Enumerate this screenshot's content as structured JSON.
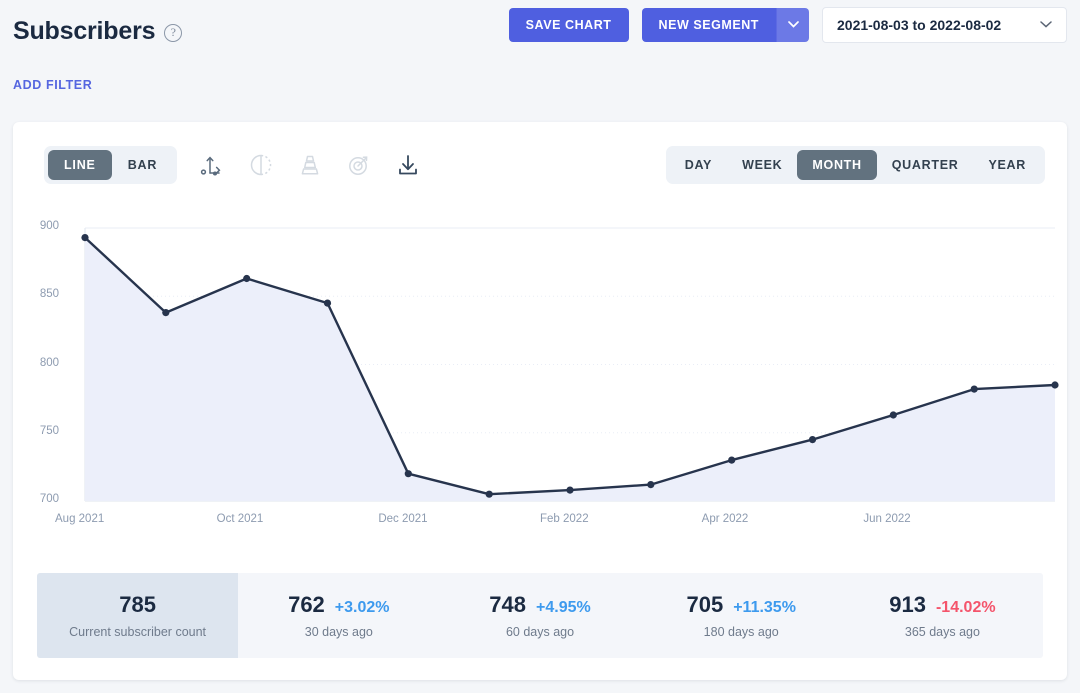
{
  "header": {
    "title": "Subscribers",
    "help_icon": "question-mark-circle-icon",
    "save_chart_label": "SAVE CHART",
    "new_segment_label": "NEW SEGMENT",
    "new_segment_caret": "⌄",
    "date_range": "2021-08-03 to 2022-08-02",
    "date_caret": "⌄",
    "add_filter_label": "ADD FILTER"
  },
  "toolbar": {
    "chart_types": [
      {
        "label": "LINE",
        "active": true
      },
      {
        "label": "BAR",
        "active": false
      }
    ],
    "icons": [
      {
        "name": "scatter-axis-icon",
        "dim": false
      },
      {
        "name": "pie-chart-icon",
        "dim": true
      },
      {
        "name": "funnel-icon",
        "dim": true
      },
      {
        "name": "goal-target-icon",
        "dim": true
      },
      {
        "name": "download-icon",
        "dim": false
      }
    ],
    "periods": [
      {
        "label": "DAY",
        "active": false
      },
      {
        "label": "WEEK",
        "active": false
      },
      {
        "label": "MONTH",
        "active": true
      },
      {
        "label": "QUARTER",
        "active": false
      },
      {
        "label": "YEAR",
        "active": false
      }
    ]
  },
  "chart_data": {
    "type": "line",
    "title": "Subscribers",
    "xlabel": "",
    "ylabel": "",
    "ylim": [
      700,
      900
    ],
    "yticks": [
      900,
      850,
      800,
      750,
      700
    ],
    "xticks": [
      "Aug 2021",
      "Oct 2021",
      "Dec 2021",
      "Feb 2022",
      "Apr 2022",
      "Jun 2022"
    ],
    "grid": true,
    "legend": "none",
    "area_fill": true,
    "line_color": "#27344d",
    "fill_color": "#eceffa",
    "categories": [
      "Aug 2021",
      "Sep 2021",
      "Oct 2021",
      "Nov 2021",
      "Dec 2021",
      "Jan 2022",
      "Feb 2022",
      "Mar 2022",
      "Apr 2022",
      "May 2022",
      "Jun 2022",
      "Jul 2022",
      "Aug 2022"
    ],
    "values": [
      893,
      838,
      863,
      845,
      720,
      705,
      708,
      712,
      730,
      745,
      763,
      782,
      785
    ]
  },
  "stats": [
    {
      "value": "785",
      "delta": "",
      "delta_dir": "none",
      "label": "Current subscriber count",
      "current": true
    },
    {
      "value": "762",
      "delta": "+3.02%",
      "delta_dir": "up",
      "label": "30 days ago",
      "current": false
    },
    {
      "value": "748",
      "delta": "+4.95%",
      "delta_dir": "up",
      "label": "60 days ago",
      "current": false
    },
    {
      "value": "705",
      "delta": "+11.35%",
      "delta_dir": "up",
      "label": "180 days ago",
      "current": false
    },
    {
      "value": "913",
      "delta": "-14.02%",
      "delta_dir": "down",
      "label": "365 days ago",
      "current": false
    }
  ],
  "colors": {
    "accent_blue": "#4f5fe0",
    "link_blue": "#5566e0",
    "toggle_active": "#62727f",
    "delta_up": "#3d9aee",
    "delta_down": "#f4546b"
  }
}
